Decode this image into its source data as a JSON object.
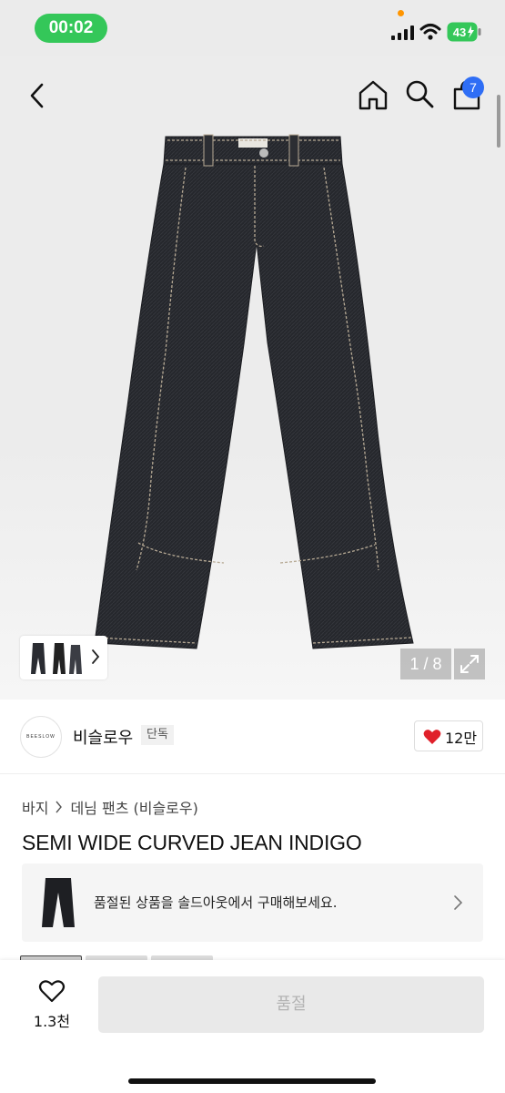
{
  "status_bar": {
    "time": "00:02",
    "battery": "43"
  },
  "header": {
    "icons": [
      "back-icon",
      "home-icon",
      "search-icon",
      "cart-icon"
    ],
    "cart_count": "7"
  },
  "gallery": {
    "counter": "1 / 8"
  },
  "brand": {
    "logo_text": "BEESLOW",
    "name": "비슬로우",
    "tag": "단독",
    "likes": "12만"
  },
  "breadcrumb": {
    "level1": "바지",
    "level2": "데님 팬츠 (비슬로우)"
  },
  "product": {
    "title": "SEMI WIDE CURVED JEAN INDIGO"
  },
  "soldout_banner": {
    "text": "품절된 상품을 솔드아웃에서 구매해보세요."
  },
  "bottom_bar": {
    "wish_count": "1.3천",
    "buy_label": "품절"
  },
  "colors": {
    "accent_blue": "#2f6ef5",
    "status_green": "#34c759",
    "heart_red": "#e0202a"
  }
}
